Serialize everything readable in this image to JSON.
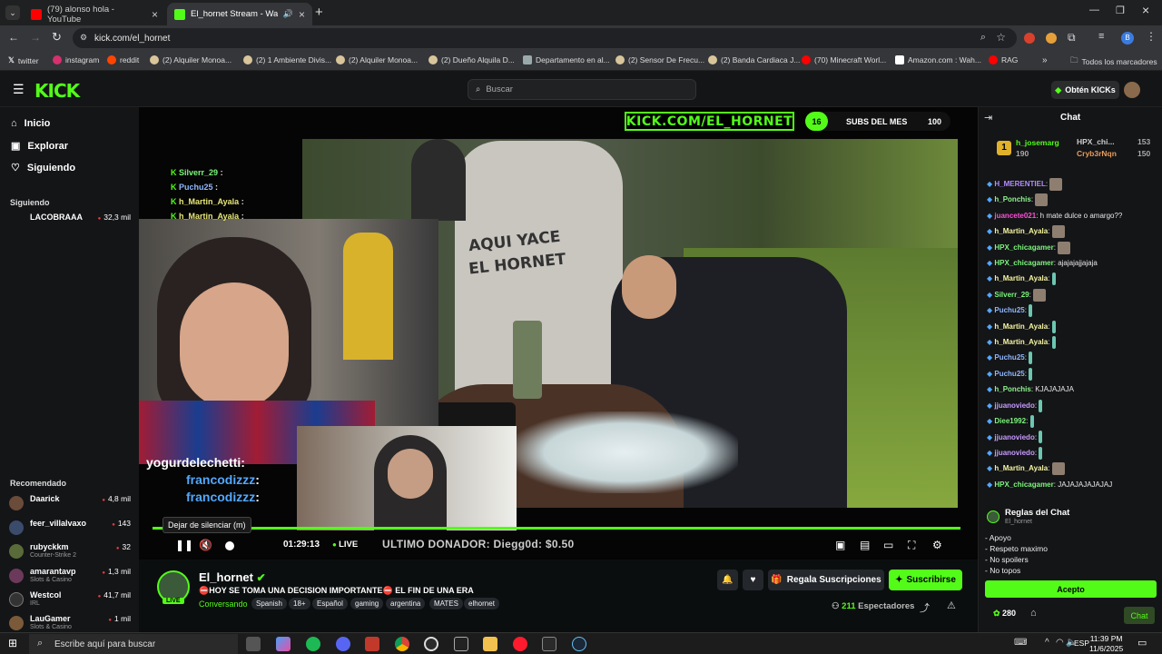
{
  "browser": {
    "tabs": [
      {
        "title": "(79) alonso hola - YouTube"
      },
      {
        "title": "El_hornet Stream - Watch L"
      }
    ],
    "url": "kick.com/el_hornet",
    "bookmarks": [
      "twitter",
      "instagram",
      "reddit",
      "(2) Alquiler Monoa...",
      "(2) 1 Ambiente Divis...",
      "(2) Alquiler Monoa...",
      "(2) Dueño Alquila D...",
      "Departamento en al...",
      "(2) Sensor De Frecu...",
      "(2) Banda Cardiaca J...",
      "(70) Minecraft Worl...",
      "Amazon.com : Wah...",
      "RAG"
    ],
    "all_bookmarks": "Todos los marcadores"
  },
  "kick": {
    "logo": "KICK",
    "search_placeholder": "Buscar",
    "kicks_button": "Obtén KICKs"
  },
  "sidebar": {
    "nav": [
      {
        "label": "Inicio",
        "icon": "home-icon"
      },
      {
        "label": "Explorar",
        "icon": "compass-icon"
      },
      {
        "label": "Siguiendo",
        "icon": "heart-icon"
      }
    ],
    "following_label": "Siguiendo",
    "following_partial": "LACOBRAAA",
    "following_partial_viewers": "32,3 mil",
    "recommended_label": "Recomendado",
    "channels": [
      {
        "name": "Daarick",
        "category": "",
        "viewers": "4,8 mil",
        "color": "#6b4b3a"
      },
      {
        "name": "feer_villalvaxo",
        "category": "",
        "viewers": "143",
        "color": "#3a4b6b"
      },
      {
        "name": "rubyckkm",
        "category": "Counter-Strike 2",
        "viewers": "32",
        "color": "#5a6b3a"
      },
      {
        "name": "amarantavp",
        "category": "Slots & Casino",
        "viewers": "1,3 mil",
        "color": "#6b3a5a"
      },
      {
        "name": "Westcol",
        "category": "IRL",
        "viewers": "41,7 mil",
        "color": "#333"
      },
      {
        "name": "LauGamer",
        "category": "Slots & Casino",
        "viewers": "1 mil",
        "color": "#7b5a3a"
      }
    ]
  },
  "player": {
    "banner": "KICK.COM/EL_HORNET",
    "subs_count_left": "16",
    "subs_label": "SUBS DEL MES",
    "subs_goal": "100",
    "meme_text_1": "AQUI YACE",
    "meme_text_2": "EL HORNET",
    "overlay_chat": [
      {
        "user": "Silverr_29",
        "text": ":",
        "color": "#7cf57c"
      },
      {
        "user": "Puchu25",
        "text": ":",
        "color": "#8fb7ff"
      },
      {
        "user": "h_Martin_Ayala",
        "text": ":",
        "color": "#e7e77a"
      },
      {
        "user": "h_Martin_Ayala",
        "text": ":",
        "color": "#e7e77a"
      }
    ],
    "webcam_chat": [
      {
        "user": "yogurdelechetti",
        "text": ":"
      },
      {
        "user": "francodizzz",
        "text": ":"
      },
      {
        "user": "francodizzz",
        "text": ":"
      }
    ],
    "tooltip": "Dejar de silenciar (m)",
    "time": "01:29:13",
    "live": "LIVE",
    "donor": "ULTIMO DONADOR: Diegg0d: $0.50",
    "progress": 1.0
  },
  "stream": {
    "name": "El_hornet",
    "live_badge": "LIVE",
    "title": "⛔HOY SE TOMA UNA DECISION IMPORTANTE⛔ EL FIN DE UNA ERA",
    "category": "Conversando",
    "tags": [
      "Spanish",
      "18+",
      "Español",
      "gaming",
      "argentina",
      "MATES",
      "elhornet"
    ],
    "gift_label": "Regala Suscripciones",
    "subscribe_label": "Suscribirse",
    "viewers_count": "211",
    "viewers_label": "Espectadores"
  },
  "chat": {
    "title": "Chat",
    "top_gifters": [
      {
        "user": "h_josemarg",
        "amount": "190"
      },
      {
        "user": "HPX_chi...",
        "amount": "153"
      },
      {
        "user": "Cryb3rNqn",
        "amount": "150"
      }
    ],
    "messages": [
      {
        "user": "H_MERENTIEL",
        "text": "",
        "color": "#b48cff",
        "emote": "img"
      },
      {
        "user": "h_Ponchis",
        "text": "",
        "color": "#8ef58e",
        "emote": "img"
      },
      {
        "user": "juancete021",
        "text": "h mate dulce o amargo??",
        "color": "#ff4fd8",
        "emote": ""
      },
      {
        "user": "h_Martin_Ayala",
        "text": "",
        "color": "#f5f5a0",
        "emote": "img"
      },
      {
        "user": "HPX_chicagamer",
        "text": "",
        "color": "#7cf57c",
        "emote": "img"
      },
      {
        "user": "HPX_chicagamer",
        "text": "ajajajajjajaja",
        "color": "#7cf57c",
        "emote": ""
      },
      {
        "user": "h_Martin_Ayala",
        "text": "",
        "color": "#f5f5a0",
        "emote": "thin"
      },
      {
        "user": "Silverr_29",
        "text": "",
        "color": "#7cf57c",
        "emote": "img"
      },
      {
        "user": "Puchu25",
        "text": "",
        "color": "#8fb7ff",
        "emote": "thin"
      },
      {
        "user": "h_Martin_Ayala",
        "text": "",
        "color": "#f5f5a0",
        "emote": "thin"
      },
      {
        "user": "h_Martin_Ayala",
        "text": "",
        "color": "#f5f5a0",
        "emote": "thin"
      },
      {
        "user": "Puchu25",
        "text": "",
        "color": "#8fb7ff",
        "emote": "thin"
      },
      {
        "user": "Puchu25",
        "text": "",
        "color": "#8fb7ff",
        "emote": "thin"
      },
      {
        "user": "h_Ponchis",
        "text": "KJAJAJAJA",
        "color": "#8ef58e",
        "emote": ""
      },
      {
        "user": "jjuanoviedo",
        "text": "",
        "color": "#c79bff",
        "emote": "thin"
      },
      {
        "user": "Diee1992",
        "text": "",
        "color": "#7cf57c",
        "emote": "thin"
      },
      {
        "user": "jjuanoviedo",
        "text": "",
        "color": "#c79bff",
        "emote": "thin"
      },
      {
        "user": "jjuanoviedo",
        "text": "",
        "color": "#c79bff",
        "emote": "thin"
      },
      {
        "user": "h_Martin_Ayala",
        "text": "",
        "color": "#f5f5a0",
        "emote": "img"
      },
      {
        "user": "HPX_chicagamer",
        "text": "JAJAJAJAJAJAJ",
        "color": "#7cf57c",
        "emote": ""
      }
    ],
    "rules_title": "Reglas del Chat",
    "rules_channel": "El_hornet",
    "rules": [
      "- Apoyo",
      "- Respeto maximo",
      "- No spoilers",
      "- No topos"
    ],
    "accept_label": "Acepto",
    "kicks_balance": "280",
    "chat_button": "Chat"
  },
  "taskbar": {
    "search_placeholder": "Escribe aquí para buscar",
    "lang": "ESP",
    "time": "11:39 PM",
    "date": "11/6/2025"
  },
  "colors": {
    "accent": "#53fc18",
    "background": "#0b0e0f",
    "panel": "#141517"
  }
}
